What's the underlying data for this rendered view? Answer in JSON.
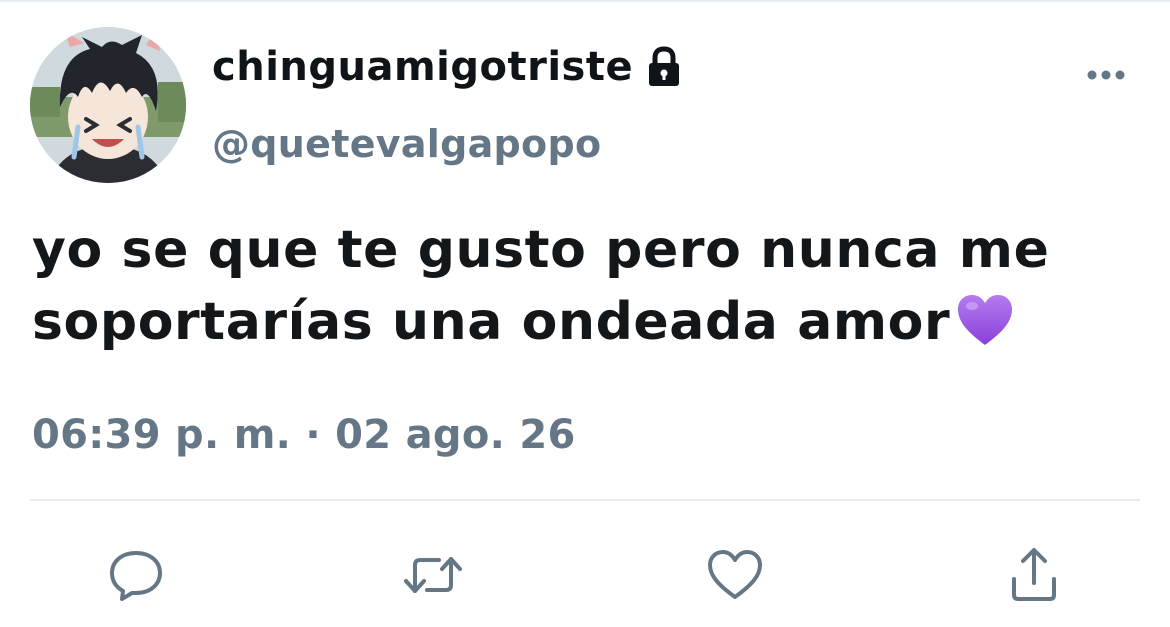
{
  "tweet": {
    "display_name": "chinguamigotriste",
    "handle": "@quetevalgapopo",
    "text": "yo se que te gusto pero nunca me soportarías una ondeada amor",
    "emoji": "purple-heart",
    "timestamp": "06:39 p. m. · 02 ago. 26",
    "protected": true
  },
  "icons": {
    "lock": "lock-icon",
    "more": "more-icon",
    "reply": "reply-icon",
    "retweet": "retweet-icon",
    "like": "like-icon",
    "share": "share-icon"
  },
  "colors": {
    "text": "#14171a",
    "secondary": "#657786",
    "divider": "#e6ecf0",
    "action_icon": "#657786",
    "heart_emoji": "#9b59e0"
  }
}
